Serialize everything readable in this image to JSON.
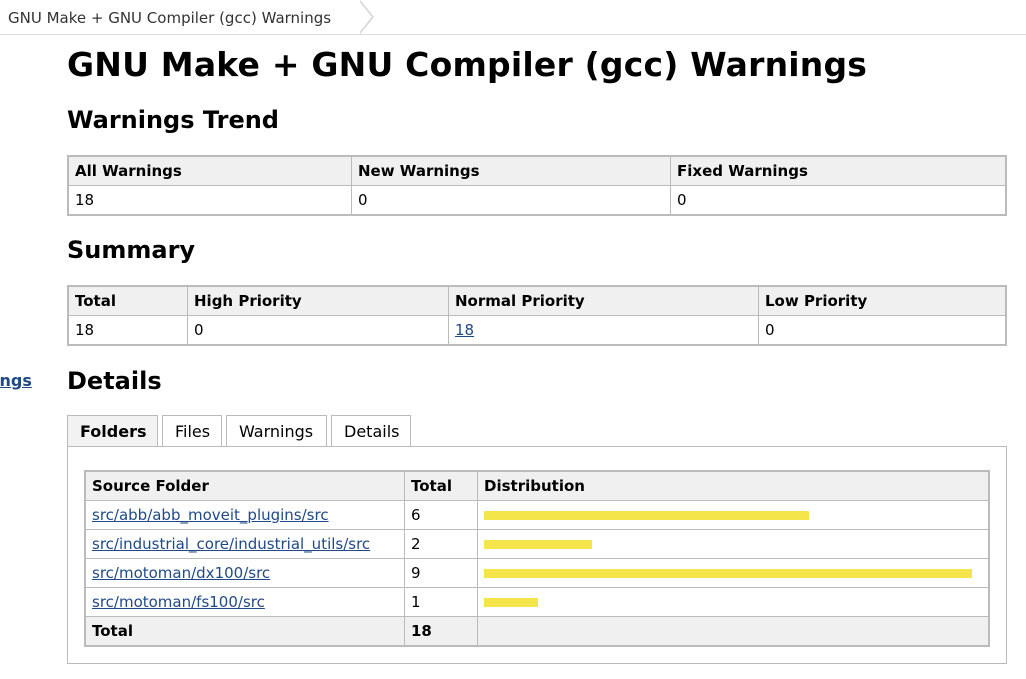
{
  "breadcrumb": {
    "title": "GNU Make + GNU Compiler (gcc) Warnings"
  },
  "side_link": "ings",
  "page_title": "GNU Make + GNU Compiler (gcc) Warnings",
  "trend": {
    "heading": "Warnings Trend",
    "headers": [
      "All Warnings",
      "New Warnings",
      "Fixed Warnings"
    ],
    "values": [
      "18",
      "0",
      "0"
    ]
  },
  "summary": {
    "heading": "Summary",
    "headers": [
      "Total",
      "High Priority",
      "Normal Priority",
      "Low Priority"
    ],
    "values": [
      "18",
      "0",
      "18",
      "0"
    ]
  },
  "details": {
    "heading": "Details",
    "tabs": [
      "Folders",
      "Files",
      "Warnings",
      "Details"
    ],
    "active_tab": "Folders",
    "folders": {
      "headers": [
        "Source Folder",
        "Total",
        "Distribution"
      ],
      "rows": [
        {
          "folder": "src/abb/abb_moveit_plugins/src",
          "total": "6",
          "fraction": 0.667
        },
        {
          "folder": "src/industrial_core/industrial_utils/src",
          "total": "2",
          "fraction": 0.222
        },
        {
          "folder": "src/motoman/dx100/src",
          "total": "9",
          "fraction": 1.0
        },
        {
          "folder": "src/motoman/fs100/src",
          "total": "1",
          "fraction": 0.111
        }
      ],
      "total_label": "Total",
      "total_value": "18"
    }
  },
  "colors": {
    "bar": "#f3e54a",
    "link": "#204a87",
    "header_bg": "#f0f0f0",
    "border": "#bbbbbb"
  }
}
